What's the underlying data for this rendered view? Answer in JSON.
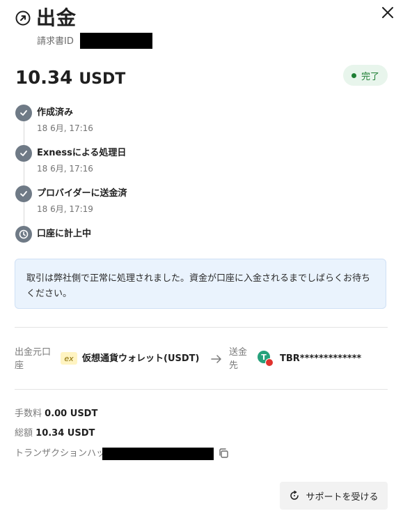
{
  "header": {
    "title": "出金",
    "invoice_label": "請求書ID"
  },
  "amount": {
    "value": "10.34",
    "currency": "USDT",
    "status": "完了"
  },
  "timeline": [
    {
      "title": "作成済み",
      "date": "18 6月, 17:16",
      "icon": "check-icon"
    },
    {
      "title": "Exnessによる処理日",
      "date": "18 6月, 17:16",
      "icon": "check-icon"
    },
    {
      "title": "プロバイダーに送金済",
      "date": "18 6月, 17:19",
      "icon": "check-icon"
    },
    {
      "title": "口座に計上中",
      "date": "",
      "icon": "clock-icon"
    }
  ],
  "notice": "取引は弊社側で正常に処理されました。資金が口座に入金されるまでしばらくお待ちください。",
  "flow": {
    "source_label": "出金元口座",
    "source_logo": "ex",
    "source_name": "仮想通貨ウォレット(USDT)",
    "dest_label": "送金先",
    "dest_value": "TBR*************"
  },
  "details": {
    "fee_label": "手数料",
    "fee_value": "0.00 USDT",
    "total_label": "総額",
    "total_value": "10.34 USDT",
    "hash_label": "トランザクションハッシュ"
  },
  "support_button": "サポートを受ける",
  "colors": {
    "success": "#1e7e34",
    "step_icon": "#6f7a86",
    "notice_bg": "#eaf3fd"
  }
}
